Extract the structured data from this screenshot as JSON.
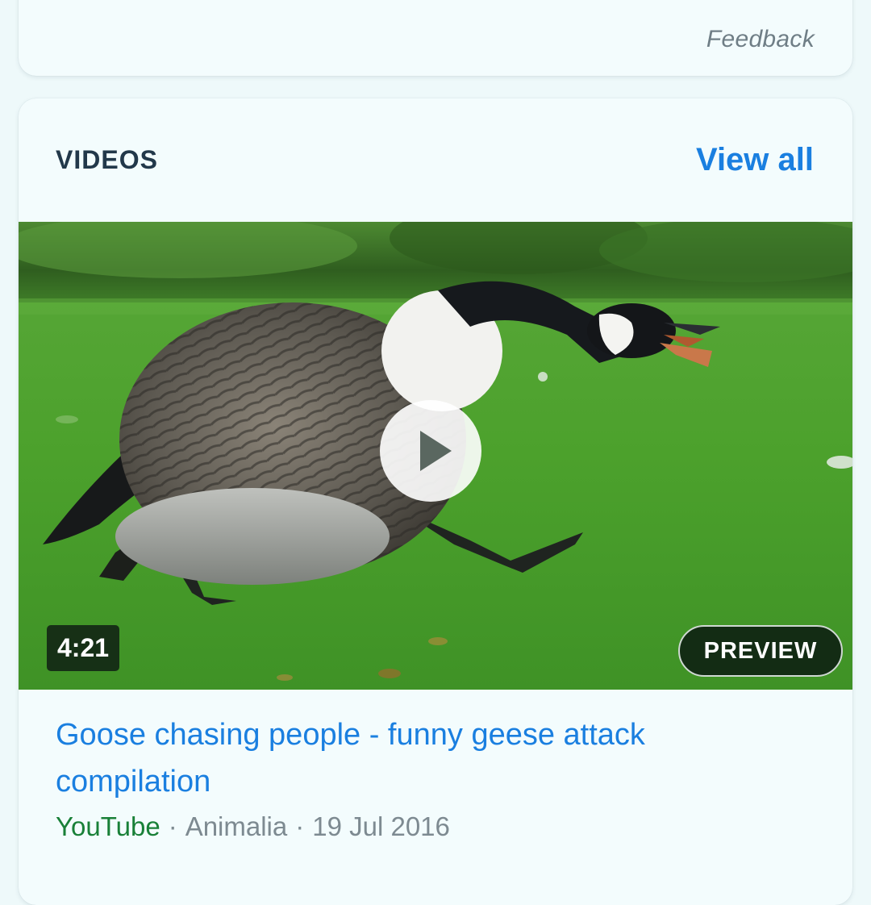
{
  "feedback_card": {
    "feedback_label": "Feedback"
  },
  "videos": {
    "section_title": "VIDEOS",
    "view_all_label": "View all",
    "item": {
      "duration": "4:21",
      "preview_label": "PREVIEW",
      "title": "Goose chasing people - funny geese attack compilation",
      "source": "YouTube",
      "separator": "·",
      "channel": "Animalia",
      "date": "19 Jul 2016",
      "play_icon": "play-icon"
    }
  },
  "colors": {
    "link": "#1a7fe0",
    "source_green": "#198038",
    "muted": "#7d8a91",
    "heading": "#22384a",
    "background": "#eef9fa"
  }
}
